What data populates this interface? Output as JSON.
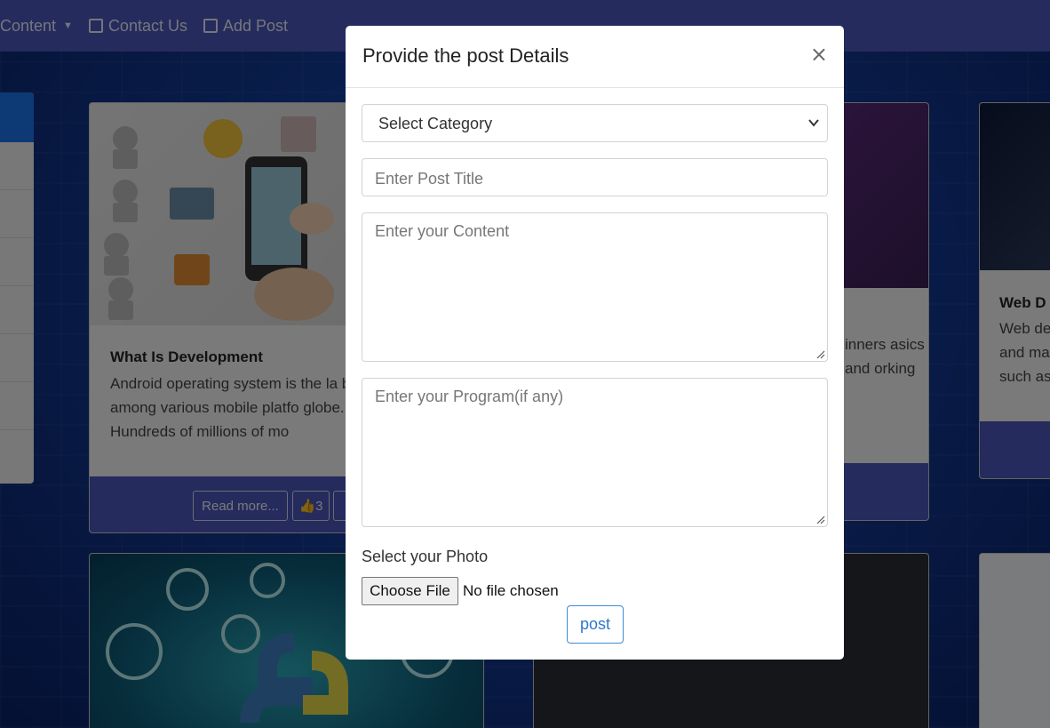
{
  "navbar": {
    "items": [
      {
        "label": "Content",
        "icon": "dropdown-caret"
      },
      {
        "label": "Contact Us",
        "icon": "contact-icon"
      },
      {
        "label": "Add Post",
        "icon": "edit-icon"
      }
    ]
  },
  "cards": [
    {
      "title": "What Is Development",
      "text": "Android operating system is the la base among various mobile platfo globe. Hundreds of millions of mo",
      "read_more": "Read more...",
      "likes": "3"
    },
    {
      "text_fragment": "inners asics and orking"
    },
    {
      "title": "Web D",
      "text": "Web de and ma such as"
    }
  ],
  "modal": {
    "title": "Provide the post Details",
    "close_symbol": "×",
    "category_select": "Select Category",
    "title_placeholder": "Enter Post Title",
    "content_placeholder": "Enter your Content",
    "program_placeholder": "Enter your Program(if any)",
    "photo_label": "Select your Photo",
    "file_button": "Choose File",
    "file_status": "No file chosen",
    "submit": "post"
  },
  "colors": {
    "navbar": "#4a57b8",
    "card_footer": "#4a57b8",
    "post_button": "#2f78c9"
  }
}
